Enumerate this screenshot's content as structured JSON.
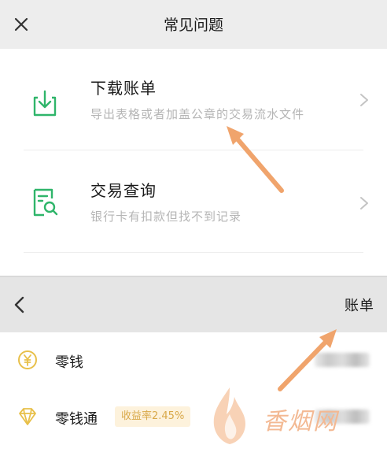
{
  "header": {
    "title": "常见问题",
    "close_icon": "close-icon"
  },
  "faq": [
    {
      "title": "下载账单",
      "subtitle": "导出表格或者加盖公章的交易流水文件",
      "icon": "download-icon"
    },
    {
      "title": "交易查询",
      "subtitle": "银行卡有扣款但找不到记录",
      "icon": "search-document-icon"
    }
  ],
  "bill_nav": {
    "back_icon": "back-arrow-icon",
    "bill_label": "账单"
  },
  "wallet": {
    "items": [
      {
        "label": "零钱",
        "icon": "yuan-coin-icon"
      },
      {
        "label": "零钱通",
        "icon": "diamond-icon",
        "badge": "收益率2.45%"
      }
    ]
  },
  "watermark": {
    "text": "香烟网"
  },
  "colors": {
    "accent_green": "#2fb56a",
    "annotation_orange": "#f0a46c",
    "coin_yellow": "#e8c04a"
  }
}
